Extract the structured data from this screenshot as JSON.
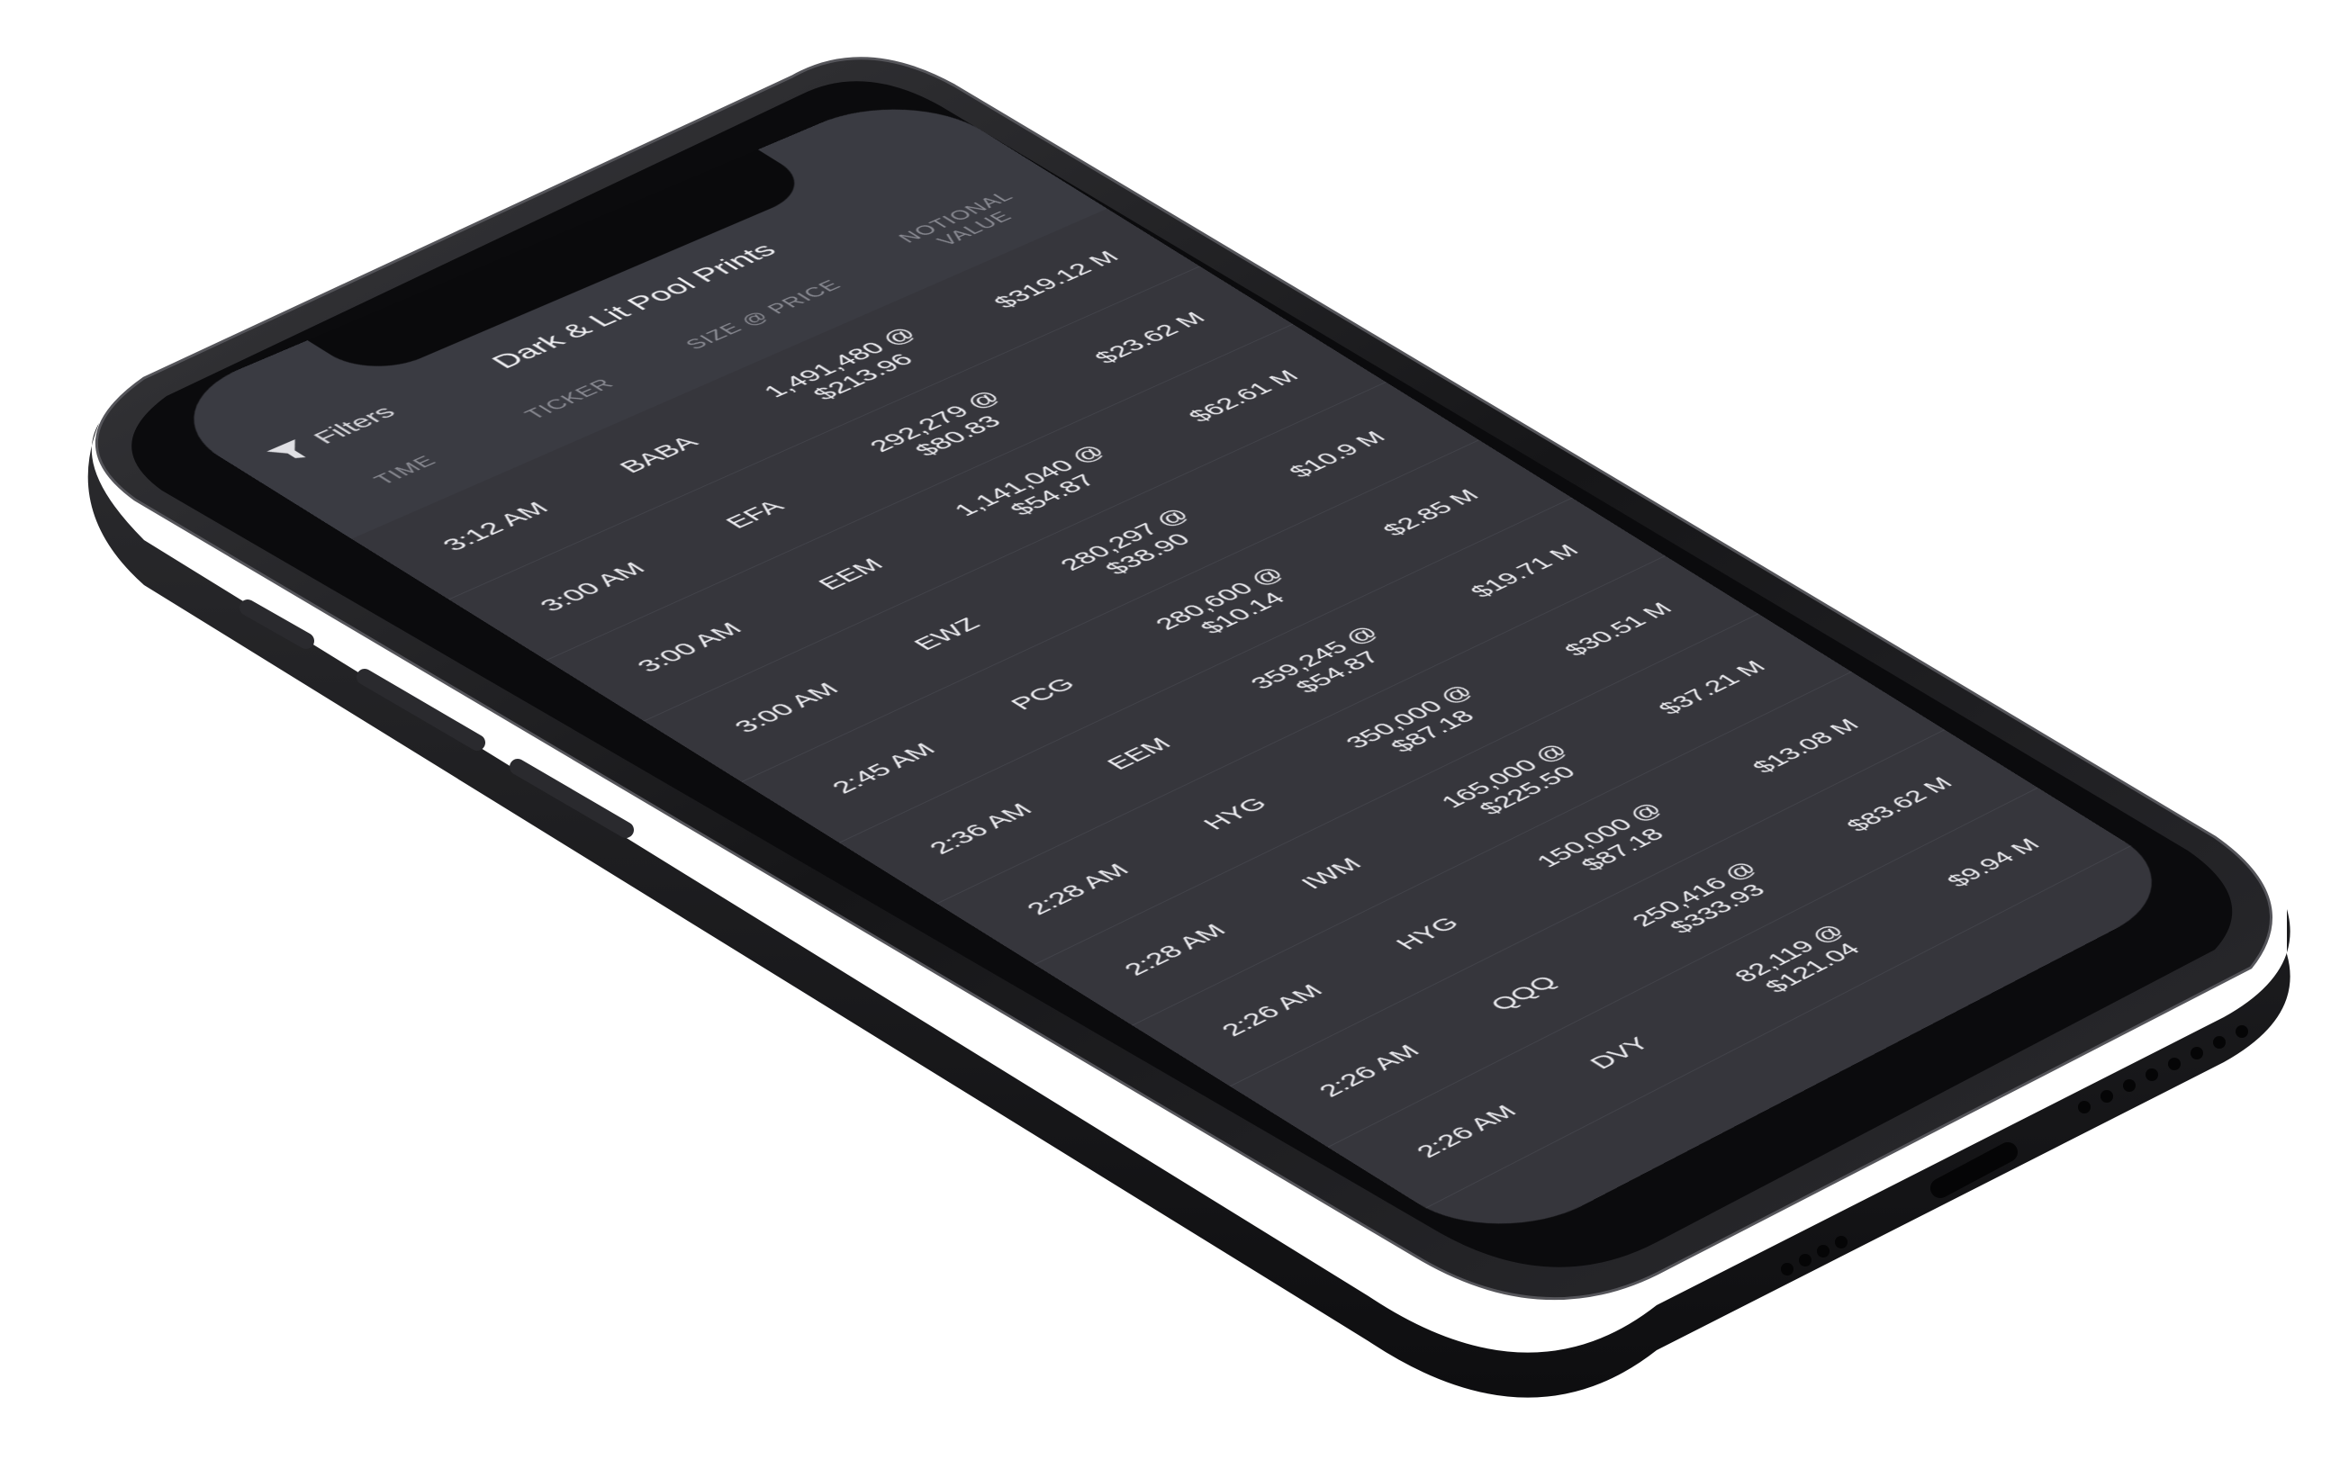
{
  "header": {
    "filters_label": "Filters",
    "title": "Dark & Lit Pool Prints"
  },
  "columns": {
    "time": "TIME",
    "ticker": "TICKER",
    "size_price": "SIZE @ PRICE",
    "notional_line1": "NOTIONAL",
    "notional_line2": "VALUE"
  },
  "rows": [
    {
      "time": "3:12 AM",
      "ticker": "BABA",
      "size": "1,491,480 @",
      "price": "$213.96",
      "value": "$319.12 M"
    },
    {
      "time": "3:00 AM",
      "ticker": "EFA",
      "size": "292,279 @",
      "price": "$80.83",
      "value": "$23.62 M"
    },
    {
      "time": "3:00 AM",
      "ticker": "EEM",
      "size": "1,141,040 @",
      "price": "$54.87",
      "value": "$62.61 M"
    },
    {
      "time": "3:00 AM",
      "ticker": "EWZ",
      "size": "280,297 @",
      "price": "$38.90",
      "value": "$10.9 M"
    },
    {
      "time": "2:45 AM",
      "ticker": "PCG",
      "size": "280,600 @",
      "price": "$10.14",
      "value": "$2.85 M"
    },
    {
      "time": "2:36 AM",
      "ticker": "EEM",
      "size": "359,245 @",
      "price": "$54.87",
      "value": "$19.71 M"
    },
    {
      "time": "2:28 AM",
      "ticker": "HYG",
      "size": "350,000 @",
      "price": "$87.18",
      "value": "$30.51 M"
    },
    {
      "time": "2:28 AM",
      "ticker": "IWM",
      "size": "165,000 @",
      "price": "$225.50",
      "value": "$37.21 M"
    },
    {
      "time": "2:26 AM",
      "ticker": "HYG",
      "size": "150,000 @",
      "price": "$87.18",
      "value": "$13.08 M"
    },
    {
      "time": "2:26 AM",
      "ticker": "QQQ",
      "size": "250,416 @",
      "price": "$333.93",
      "value": "$83.62 M"
    },
    {
      "time": "2:26 AM",
      "ticker": "DVY",
      "size": "82,119 @",
      "price": "$121.04",
      "value": "$9.94 M"
    }
  ],
  "colors": {
    "screen_bg": "#36363c",
    "header_bg": "#3a3b42",
    "phone_frame": "#1c1c1f",
    "text_primary": "#ececf0",
    "text_muted": "#8b8c94"
  },
  "icons": {
    "filter": "funnel-icon"
  }
}
